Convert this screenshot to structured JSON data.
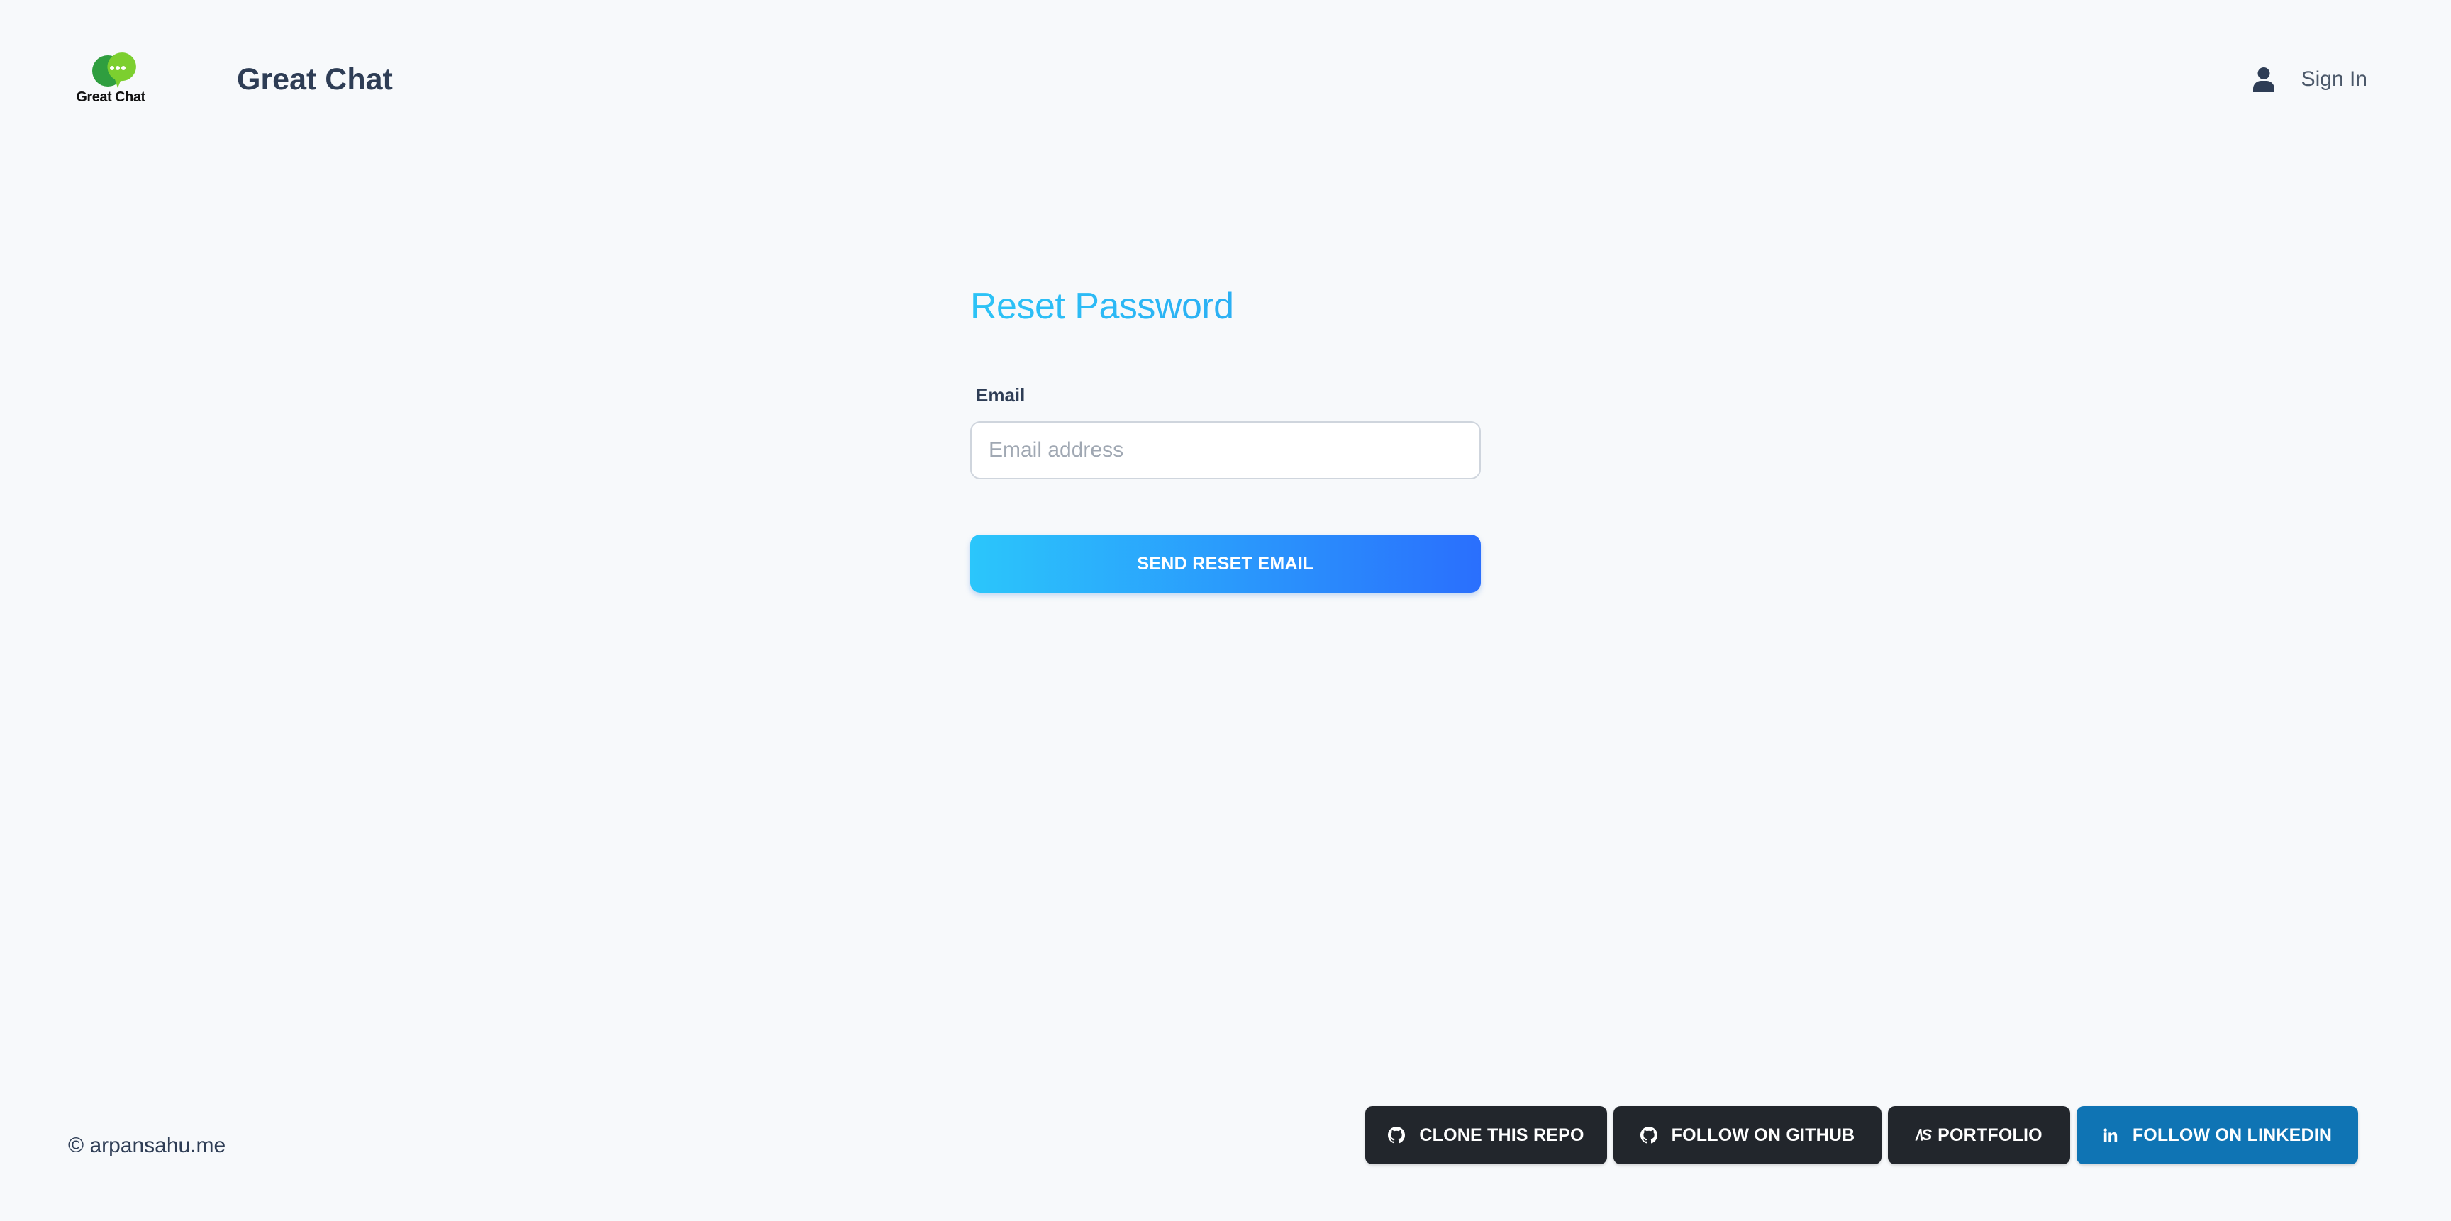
{
  "header": {
    "logo_text": "Great Chat",
    "app_title": "Great Chat",
    "signin_label": "Sign In",
    "signin_icon": "user-icon"
  },
  "form": {
    "title": "Reset Password",
    "email_label": "Email",
    "email_placeholder": "Email address",
    "email_value": "",
    "submit_label": "SEND RESET EMAIL"
  },
  "footer": {
    "copyright": "© arpansahu.me",
    "links": [
      {
        "label": "CLONE THIS REPO",
        "icon": "github-icon"
      },
      {
        "label": "FOLLOW ON GITHUB",
        "icon": "github-icon"
      },
      {
        "label": "PORTFOLIO",
        "icon": "portfolio-icon"
      },
      {
        "label": "FOLLOW ON LINKEDIN",
        "icon": "linkedin-icon"
      }
    ]
  },
  "colors": {
    "background": "#f7f9fb",
    "title_gradient_start": "#2cc3f6",
    "title_gradient_end": "#2a9df2",
    "button_gradient_start": "#2bc6fb",
    "button_gradient_end": "#2a6ffd",
    "dark_button": "#22262c",
    "linkedin_button": "#0f74b4",
    "text_dark": "#2e3d55"
  }
}
